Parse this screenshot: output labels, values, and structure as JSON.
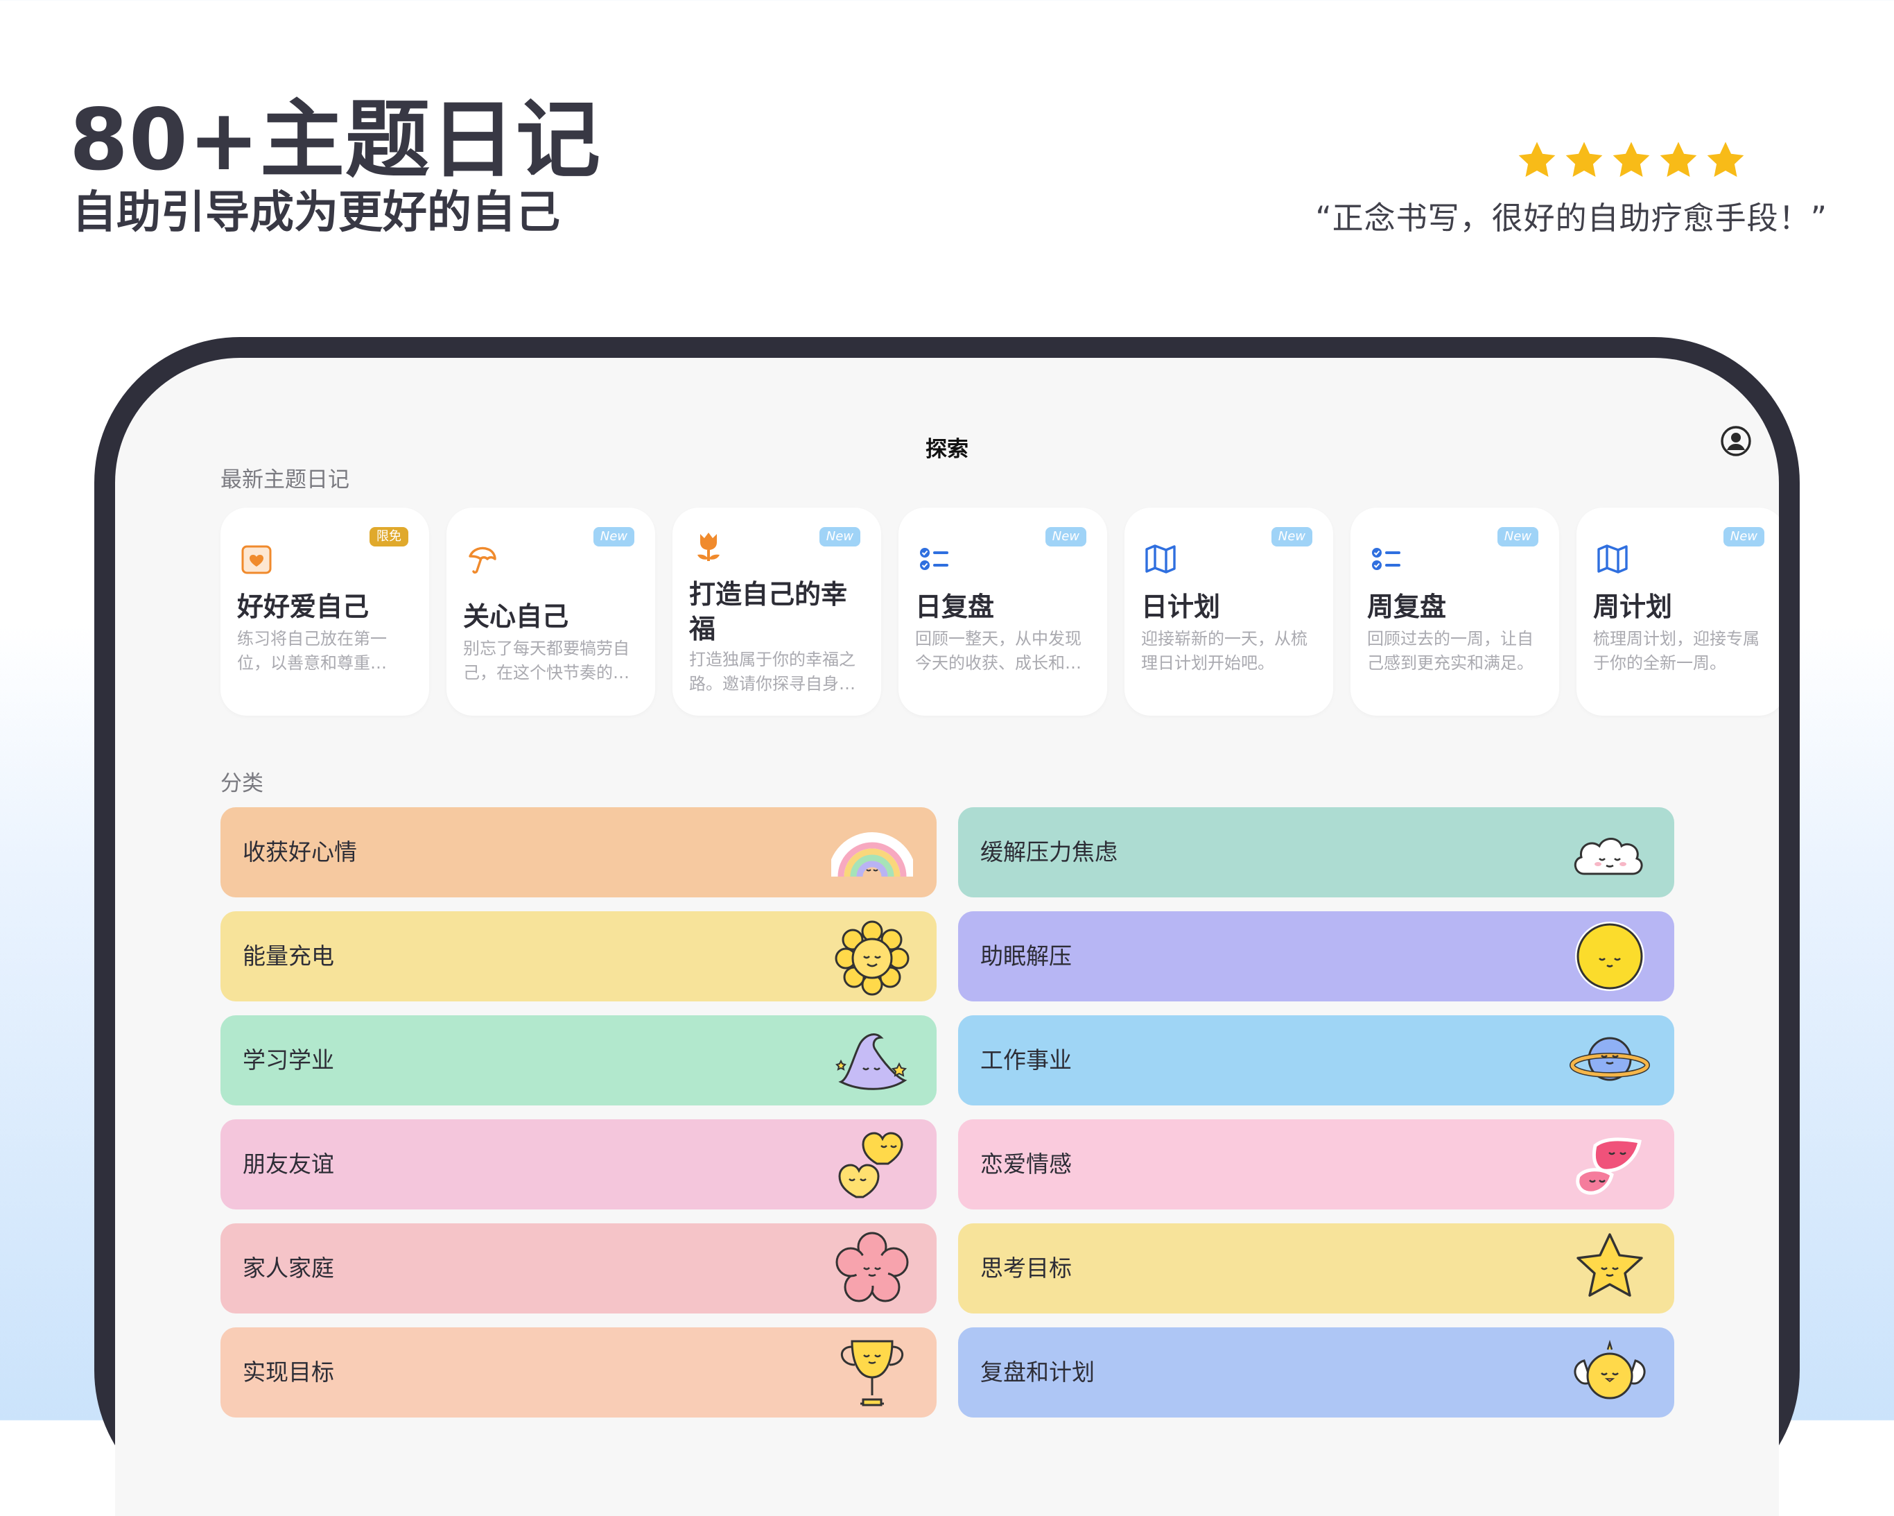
{
  "promo": {
    "headline": "80+主题日记",
    "subheadline": "自助引导成为更好的自己",
    "rating_stars": 5,
    "quote": "“正念书写，很好的自助疗愈手段！”"
  },
  "app": {
    "nav_title": "探索",
    "latest_section_label": "最新主题日记",
    "category_section_label": "分类",
    "latest_cards": [
      {
        "title": "好好爱自己",
        "desc": "练习将自己放在第一位，以善意和尊重…",
        "badge": "限免",
        "badge_color": "#e0a92c",
        "icon": "heart-frame-icon",
        "icon_color": "#f08a2c"
      },
      {
        "title": "关心自己",
        "desc": "别忘了每天都要犒劳自己，在这个快节奏的…",
        "badge": "New",
        "badge_color": "#9fd3f7",
        "icon": "umbrella-icon",
        "icon_color": "#f08a2c"
      },
      {
        "title": "打造自己的幸福",
        "desc": "打造独属于你的幸福之路。邀请你探寻自身…",
        "badge": "New",
        "badge_color": "#9fd3f7",
        "icon": "tulip-icon",
        "icon_color": "#f08a2c"
      },
      {
        "title": "日复盘",
        "desc": "回顾一整天，从中发现今天的收获、成长和…",
        "badge": "New",
        "badge_color": "#9fd3f7",
        "icon": "checklist-icon",
        "icon_color": "#2f6fdf"
      },
      {
        "title": "日计划",
        "desc": "迎接崭新的一天，从梳理日计划开始吧。",
        "badge": "New",
        "badge_color": "#9fd3f7",
        "icon": "map-icon",
        "icon_color": "#2f6fdf"
      },
      {
        "title": "周复盘",
        "desc": "回顾过去的一周，让自己感到更充实和满足。",
        "badge": "New",
        "badge_color": "#9fd3f7",
        "icon": "checklist-icon",
        "icon_color": "#2f6fdf"
      },
      {
        "title": "周计划",
        "desc": "梳理周计划，迎接专属于你的全新一周。",
        "badge": "New",
        "badge_color": "#9fd3f7",
        "icon": "map-icon",
        "icon_color": "#2f6fdf"
      }
    ],
    "categories": [
      {
        "label": "收获好心情",
        "color": "#f6c9a0",
        "sticker": "rainbow-sticker-icon"
      },
      {
        "label": "缓解压力焦虑",
        "color": "#addcd2",
        "sticker": "cloud-sticker-icon"
      },
      {
        "label": "能量充电",
        "color": "#f7e39a",
        "sticker": "sunflower-sticker-icon"
      },
      {
        "label": "助眠解压",
        "color": "#b7b6f4",
        "sticker": "moon-sticker-icon"
      },
      {
        "label": "学习学业",
        "color": "#b2e8cd",
        "sticker": "wizard-hat-sticker-icon"
      },
      {
        "label": "工作事业",
        "color": "#9fd5f5",
        "sticker": "planet-sticker-icon"
      },
      {
        "label": "朋友友谊",
        "color": "#f4c6dc",
        "sticker": "hearts-sticker-icon"
      },
      {
        "label": "恋爱情感",
        "color": "#facbdd",
        "sticker": "love-hearts-sticker-icon"
      },
      {
        "label": "家人家庭",
        "color": "#f5c4c8",
        "sticker": "flower-sticker-icon"
      },
      {
        "label": "思考目标",
        "color": "#f7e39a",
        "sticker": "star-sticker-icon"
      },
      {
        "label": "实现目标",
        "color": "#f9cdb6",
        "sticker": "trophy-sticker-icon"
      },
      {
        "label": "复盘和计划",
        "color": "#aec6f5",
        "sticker": "chick-sticker-icon"
      }
    ]
  }
}
